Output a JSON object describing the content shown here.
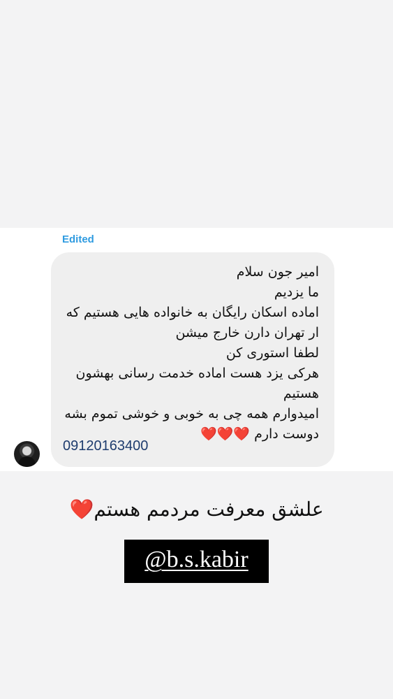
{
  "message": {
    "edited_label": "Edited",
    "lines": [
      "امیر جون سلام",
      "ما یزدیم",
      "اماده اسکان رایگان به خانواده هایی هستیم که",
      "ار تهران دارن خارج میشن",
      "لطفا استوری کن",
      "هرکی یزد هست اماده خدمت رسانی بهشون",
      "هستیم",
      "امیدوارم همه چی به خوبی و خوشی تموم بشه"
    ],
    "closing_text": "دوست دارم",
    "closing_hearts": "❤️❤️❤️",
    "phone": "09120163400"
  },
  "story": {
    "caption": "علشق معرفت مردمم هستم",
    "caption_heart": "❤️",
    "handle": "@b.s.kabir"
  },
  "colors": {
    "background": "#f3f3f4",
    "chat_panel": "#ffffff",
    "bubble": "#efefef",
    "edited": "#2f9be0",
    "phone_link": "#1e3c6e",
    "heart": "#e0141e"
  }
}
